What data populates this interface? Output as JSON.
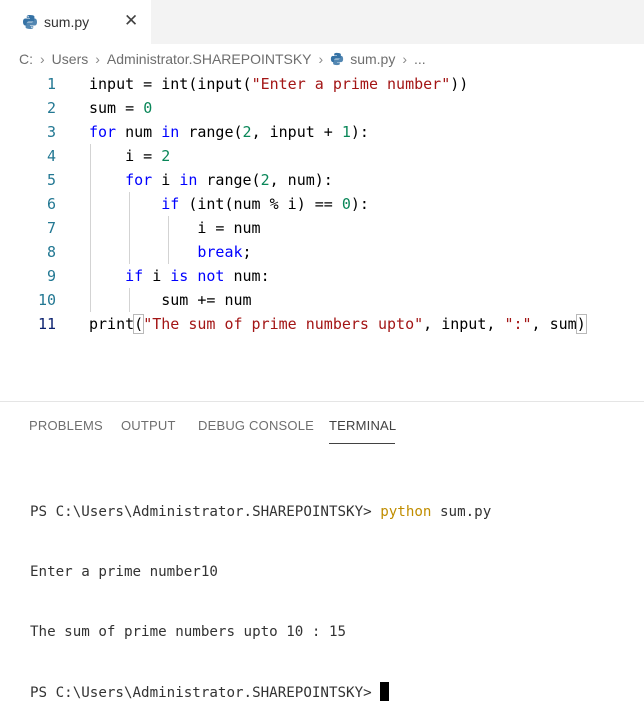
{
  "tab": {
    "filename": "sum.py",
    "close_glyph": "✕"
  },
  "breadcrumb": {
    "segments": [
      "C:",
      "Users",
      "Administrator.SHAREPOINTSKY"
    ],
    "file": "sum.py",
    "ellipsis": "...",
    "separator": "›"
  },
  "editor": {
    "line_numbers": [
      "1",
      "2",
      "3",
      "4",
      "5",
      "6",
      "7",
      "8",
      "9",
      "10",
      "11"
    ],
    "active_line": "11",
    "code_lines": [
      "input = int(input(\"Enter a prime number\"))",
      "sum = 0",
      "for num in range(2, input + 1):",
      "    i = 2",
      "    for i in range(2, num):",
      "        if (int(num % i) == 0):",
      "            i = num",
      "            break;",
      "    if i is not num:",
      "        sum += num",
      "print(\"The sum of prime numbers upto\", input, \":\", sum)"
    ],
    "colors": {
      "keyword": "#0000ff",
      "control": "#af00db",
      "number": "#098658",
      "string": "#a31515",
      "line_number": "#237893"
    }
  },
  "panel": {
    "tabs": [
      "PROBLEMS",
      "OUTPUT",
      "DEBUG CONSOLE",
      "TERMINAL"
    ],
    "active_tab": "TERMINAL",
    "terminal": {
      "prompt1": "PS C:\\Users\\Administrator.SHAREPOINTSKY> ",
      "command": "python",
      "command_arg": " sum.py",
      "output1": "Enter a prime number10",
      "output2": "The sum of prime numbers upto 10 : 15",
      "prompt2": "PS C:\\Users\\Administrator.SHAREPOINTSKY> "
    }
  }
}
